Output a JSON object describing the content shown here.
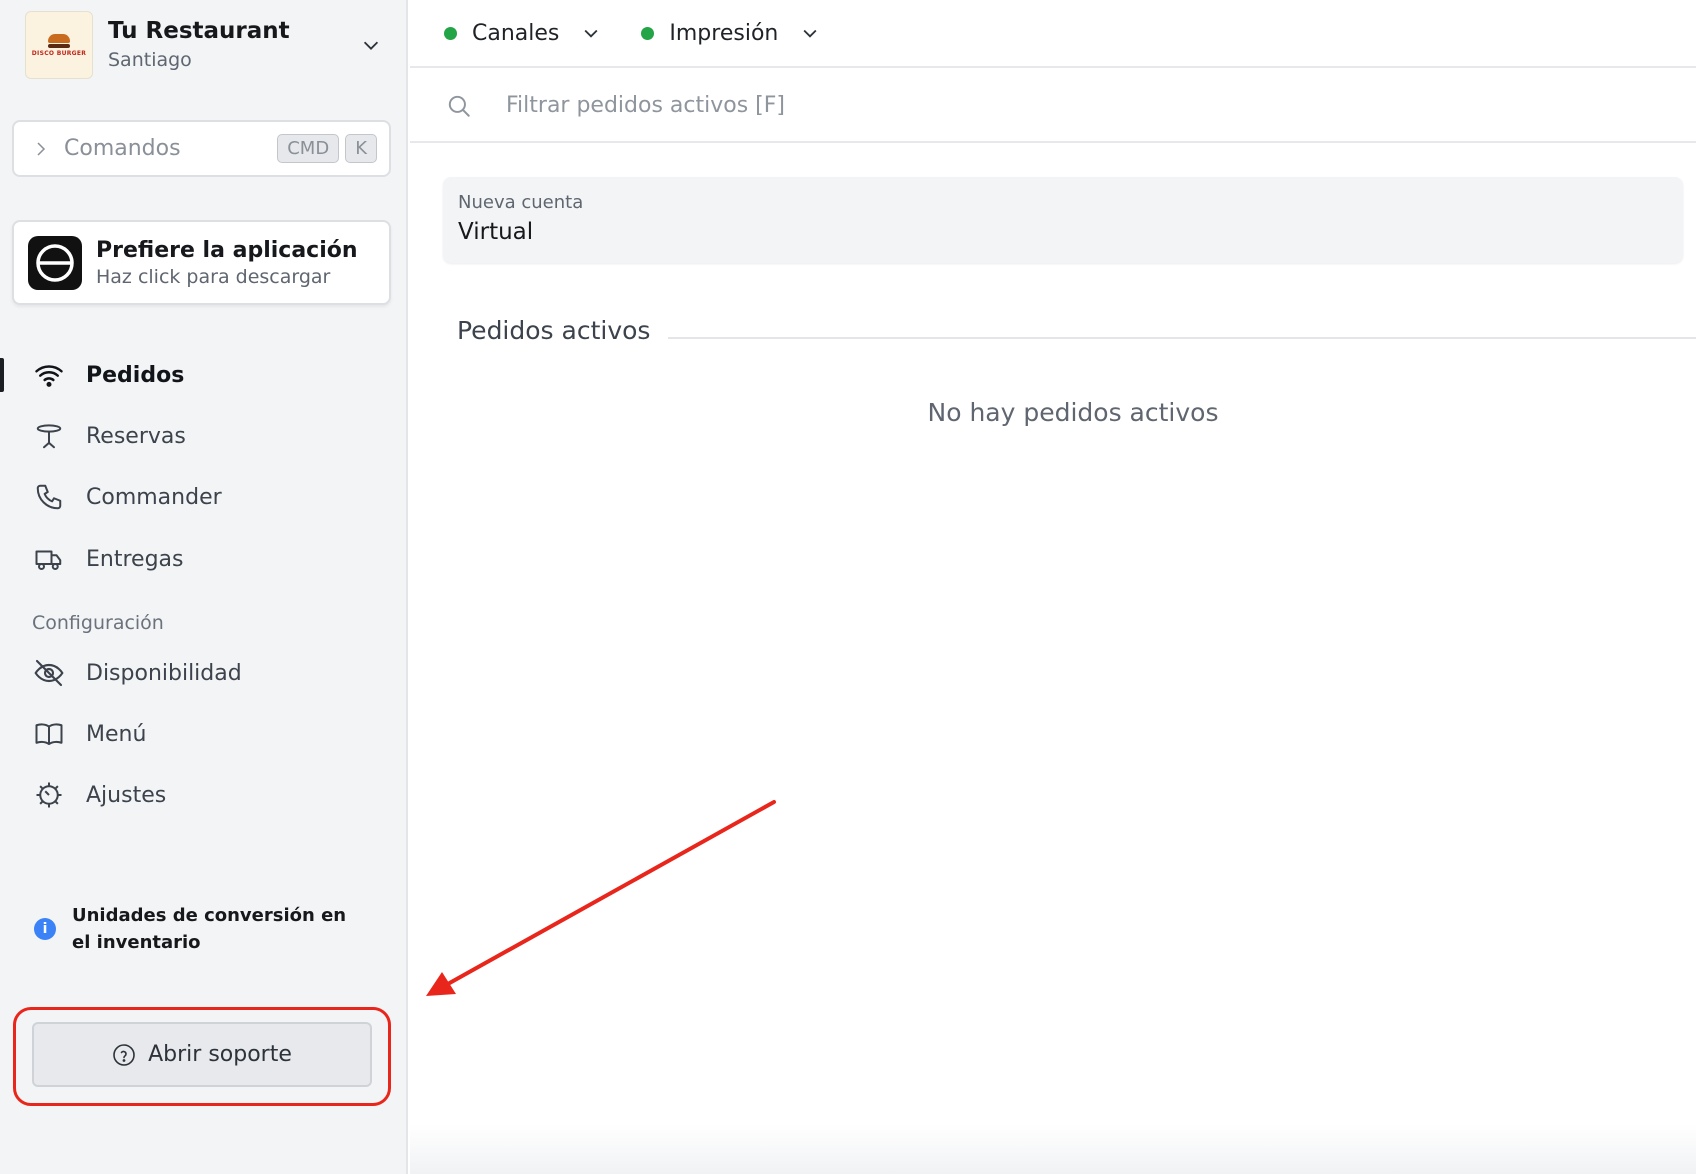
{
  "restaurant": {
    "name": "Tu Restaurant",
    "city": "Santiago",
    "logo_text": "DISCO BURGER"
  },
  "commands": {
    "label": "Comandos",
    "key1": "CMD",
    "key2": "K"
  },
  "app_promo": {
    "title": "Prefiere la aplicación",
    "subtitle": "Haz click para descargar"
  },
  "nav": {
    "items": [
      {
        "label": "Pedidos",
        "icon": "wifi-icon",
        "active": true
      },
      {
        "label": "Reservas",
        "icon": "table-icon"
      },
      {
        "label": "Commander",
        "icon": "phone-icon"
      },
      {
        "label": "Entregas",
        "icon": "truck-icon"
      }
    ],
    "section_label": "Configuración",
    "config_items": [
      {
        "label": "Disponibilidad",
        "icon": "eye-off-icon"
      },
      {
        "label": "Menú",
        "icon": "book-icon"
      },
      {
        "label": "Ajustes",
        "icon": "gear-icon"
      }
    ]
  },
  "info": {
    "text": "Unidades de conversión en el inventario",
    "icon_glyph": "i"
  },
  "support": {
    "label": "Abrir soporte"
  },
  "topbar": {
    "channels": {
      "label": "Canales",
      "status_color": "#22a447"
    },
    "printing": {
      "label": "Impresión",
      "status_color": "#22a447"
    }
  },
  "search": {
    "placeholder": "Filtrar pedidos activos [F]",
    "value": ""
  },
  "account": {
    "label": "Nueva cuenta",
    "value": "Virtual"
  },
  "orders": {
    "heading": "Pedidos activos",
    "empty": "No hay pedidos activos"
  },
  "annotation": {
    "color": "#e8261c"
  }
}
